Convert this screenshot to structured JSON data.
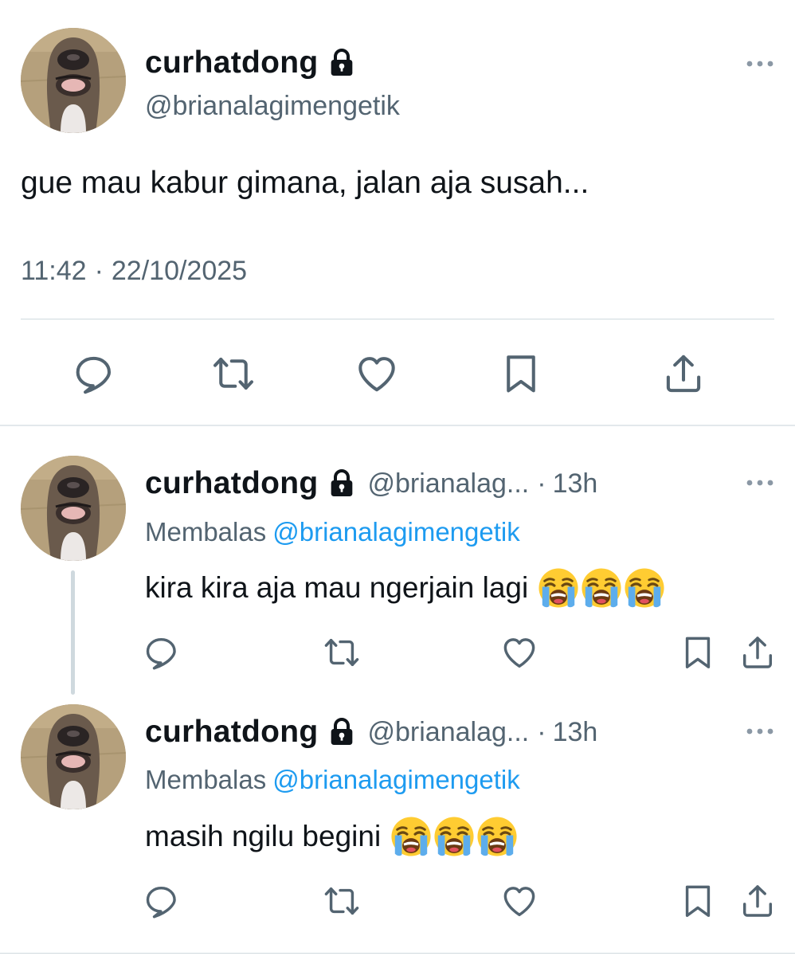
{
  "main_tweet": {
    "display_name": "curhatdong",
    "handle": "@brianalagimengetik",
    "text": "gue mau kabur gimana, jalan aja susah...",
    "time": "11:42",
    "separator": "·",
    "date": "22/10/2025"
  },
  "replies": [
    {
      "display_name": "curhatdong",
      "handle": "@brianalag...",
      "separator": "·",
      "time_ago": "13h",
      "replying_label": "Membalas",
      "replying_to": "@brianalagimengetik",
      "text": "kira kira aja mau ngerjain lagi",
      "emojis": [
        "crying-face-emoji",
        "crying-face-emoji",
        "crying-face-emoji"
      ]
    },
    {
      "display_name": "curhatdong",
      "handle": "@brianalag...",
      "separator": "·",
      "time_ago": "13h",
      "replying_label": "Membalas",
      "replying_to": "@brianalagimengetik",
      "text": "masih ngilu begini",
      "emojis": [
        "crying-face-emoji",
        "crying-face-emoji",
        "crying-face-emoji"
      ]
    }
  ],
  "actions": [
    "reply-icon",
    "retweet-icon",
    "like-icon",
    "bookmark-icon",
    "share-icon"
  ],
  "colors": {
    "text": "#0f1419",
    "secondary": "#536471",
    "link": "#1d9bf0",
    "divider": "#cfd9de"
  }
}
